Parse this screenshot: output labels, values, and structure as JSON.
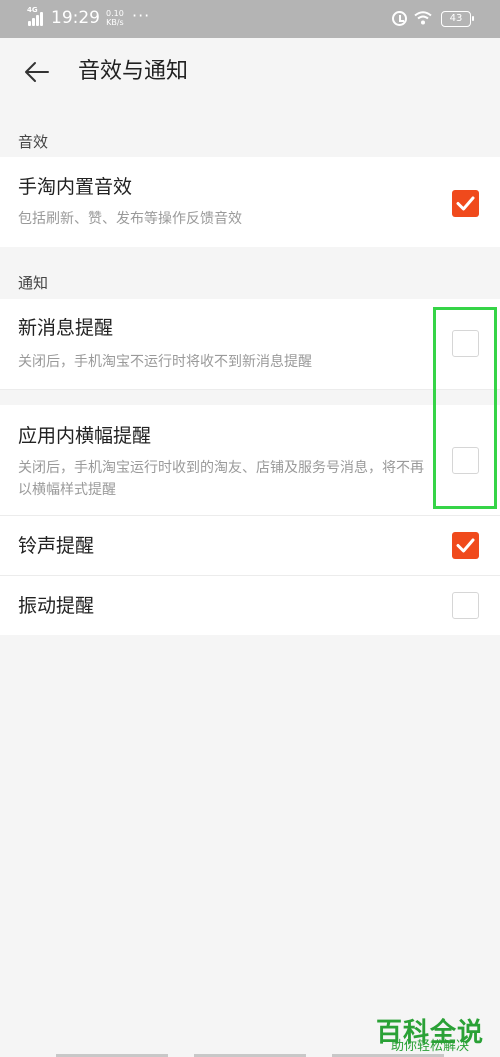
{
  "status_bar": {
    "network": "4G",
    "time": "19:29",
    "speed_value": "0.10",
    "speed_unit": "KB/s",
    "more": "···",
    "battery": "43"
  },
  "header": {
    "title": "音效与通知"
  },
  "sections": {
    "sound": {
      "label": "音效",
      "items": [
        {
          "title": "手淘内置音效",
          "desc": "包括刷新、赞、发布等操作反馈音效",
          "checked": true
        }
      ]
    },
    "notify": {
      "label": "通知",
      "items": [
        {
          "title": "新消息提醒",
          "desc": "关闭后，手机淘宝不运行时将收不到新消息提醒",
          "checked": false
        },
        {
          "title": "应用内横幅提醒",
          "desc": "关闭后，手机淘宝运行时收到的淘友、店铺及服务号消息，将不再以横幅样式提醒",
          "checked": false
        },
        {
          "title": "铃声提醒",
          "checked": true
        },
        {
          "title": "振动提醒",
          "checked": false
        }
      ]
    }
  },
  "watermark": {
    "title": "百科全说",
    "subtitle": "助你轻松解决"
  },
  "colors": {
    "accent": "#f04a1c",
    "highlight": "#35d447",
    "watermark": "#2aa136"
  }
}
